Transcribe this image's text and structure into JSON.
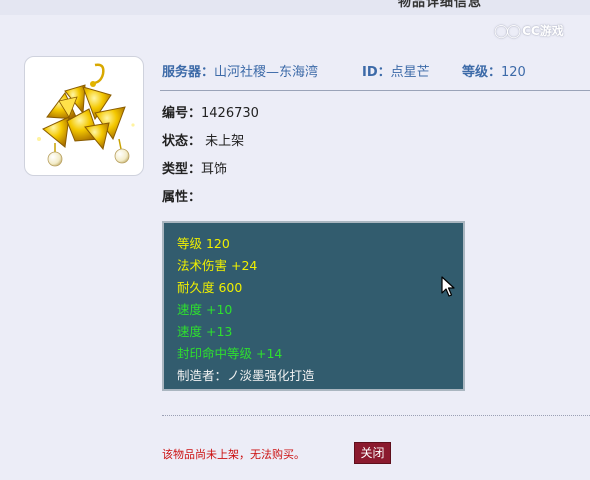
{
  "dialog": {
    "title": "物品详细信息"
  },
  "watermark": {
    "mark": "CC",
    "text": "CC游戏"
  },
  "header": {
    "server_label": "服务器：",
    "server_value": "山河社稷—东海湾",
    "id_label": "ID：",
    "id_value": "点星芒",
    "level_label": "等级：",
    "level_value": "120"
  },
  "details": {
    "number_label": "编号：",
    "number_value": "1426730",
    "status_label": "状态：",
    "status_value": "未上架",
    "type_label": "类型：",
    "type_value": "耳饰",
    "attributes_label": "属性："
  },
  "attributes": [
    {
      "text": "等级 120",
      "color": "#f0f000"
    },
    {
      "text": "法术伤害 +24",
      "color": "#f0f000"
    },
    {
      "text": "耐久度 600",
      "color": "#f0f000"
    },
    {
      "text": "速度 +10",
      "color": "#2ee02e"
    },
    {
      "text": "速度 +13",
      "color": "#2ee02e"
    },
    {
      "text": "封印命中等级 +14",
      "color": "#2ee02e"
    },
    {
      "text": "制造者：ノ淡墨强化打造",
      "color": "#f2f2f2"
    }
  ],
  "footer": {
    "notice": "该物品尚未上架，无法购买。",
    "close_label": "关闭"
  },
  "icons": {
    "item": "golden-leaf-earring-icon",
    "cursor": "mouse-pointer-icon"
  }
}
